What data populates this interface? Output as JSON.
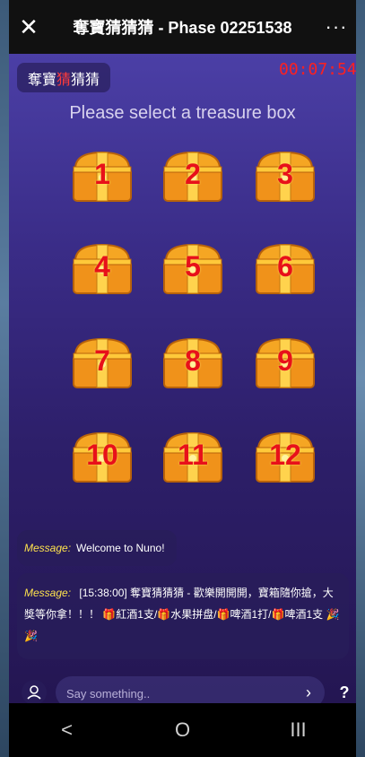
{
  "titlebar": {
    "title": "奪寶猜猜猜 - Phase 02251538",
    "close_icon": "close-icon",
    "more_icon": "more-icon"
  },
  "game": {
    "name_prefix": "奪寶",
    "name_highlight": "猜",
    "name_suffix": "猜猜",
    "timer": "00:07:54",
    "prompt": "Please select a treasure box",
    "boxes": [
      "1",
      "2",
      "3",
      "4",
      "5",
      "6",
      "7",
      "8",
      "9",
      "10",
      "11",
      "12"
    ]
  },
  "messages": [
    {
      "label": "Message:",
      "text": "Welcome to Nuno!"
    },
    {
      "label": "Message:",
      "text": "[15:38:00] 奪寶猜猜猜 - 歡樂開開開，寶箱隨你搶，大獎等你拿！！！ 🎁紅酒1支/🎁水果拼盘/🎁啤酒1打/🎁啤酒1支 🎉🎉"
    }
  ],
  "input": {
    "placeholder": "Say something..",
    "send_icon": "send-icon",
    "help": "?"
  },
  "navbar": {
    "back": "<",
    "home": "O",
    "recents": "III"
  }
}
